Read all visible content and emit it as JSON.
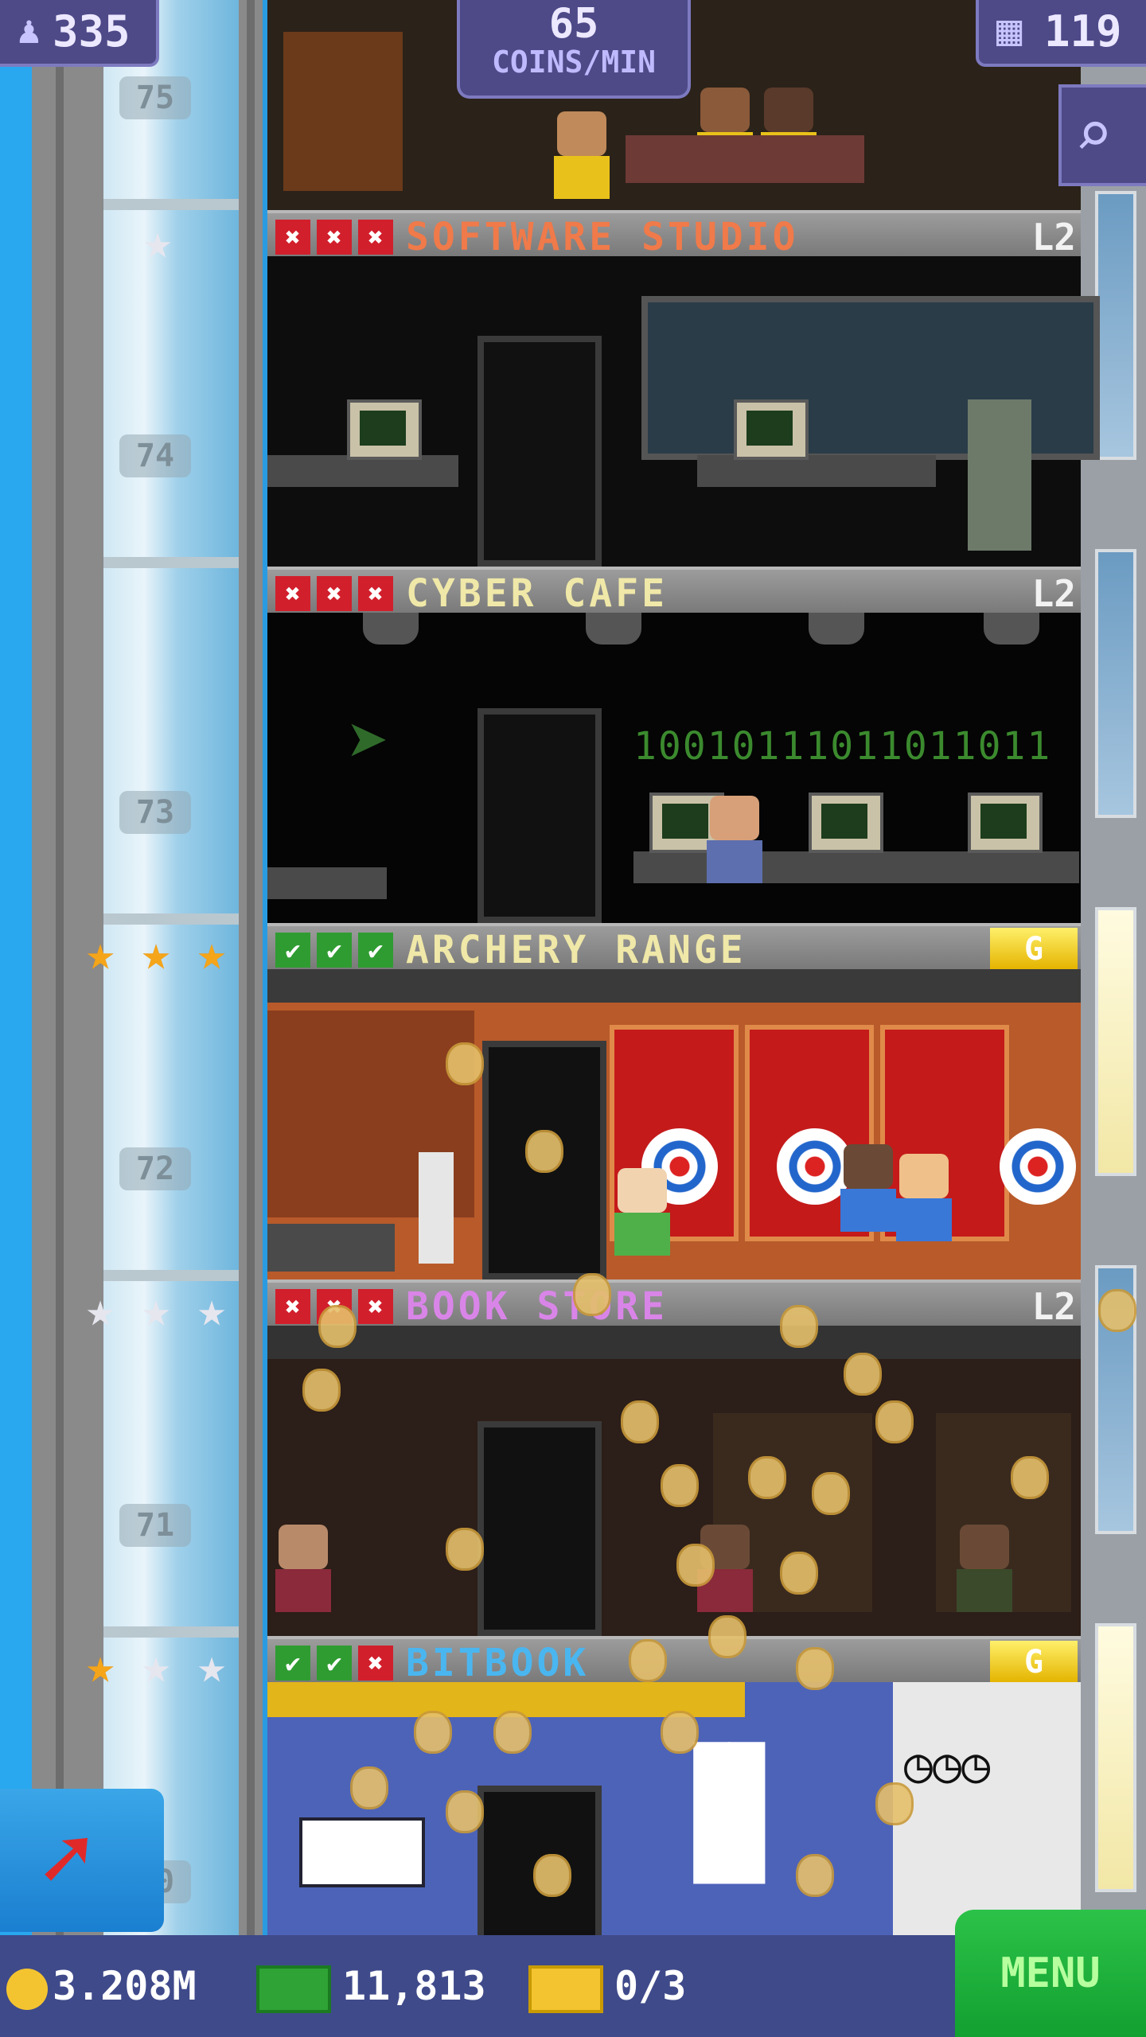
{
  "hud": {
    "population": "335",
    "coins_rate_value": "65",
    "coins_rate_unit": "COINS/MIN",
    "floors": "119"
  },
  "shaft": {
    "floor_numbers": [
      "75",
      "74",
      "73",
      "72",
      "71",
      "70"
    ]
  },
  "floors": [
    {
      "name": "SOFTWARE STUDIO",
      "level": "L2",
      "marks": [
        "x",
        "x",
        "x"
      ],
      "title_color": "#f07a4a",
      "stars": [
        "silver"
      ]
    },
    {
      "name": "CYBER CAFE",
      "level": "L2",
      "marks": [
        "x",
        "x",
        "x"
      ],
      "title_color": "#f0e8a8",
      "stars": []
    },
    {
      "name": "ARCHERY RANGE",
      "level": "G",
      "marks": [
        "ok",
        "ok",
        "ok"
      ],
      "title_color": "#f0e8a8",
      "stars": [
        "gold",
        "gold",
        "gold"
      ]
    },
    {
      "name": "BOOK STORE",
      "level": "L2",
      "marks": [
        "x",
        "x",
        "x"
      ],
      "title_color": "#d985e8",
      "stars": [
        "silver",
        "silver",
        "silver"
      ]
    },
    {
      "name": "BITBOOK",
      "level": "G",
      "marks": [
        "ok",
        "ok",
        "x"
      ],
      "title_color": "#4ab6f0",
      "stars": [
        "gold",
        "silver",
        "silver"
      ]
    }
  ],
  "scenery": {
    "binary_text": "10010111011011011"
  },
  "bottom": {
    "coins": "3.208M",
    "bux": "11,813",
    "tickets": "0/3",
    "menu_label": "MENU"
  },
  "colors": {
    "sky": "#29a8ef",
    "hud_bg": "#4e4a88",
    "menu_bg": "#12a030",
    "check": "#2f9c32",
    "cross": "#d21f2c"
  },
  "icons": [
    "person-icon",
    "building-icon",
    "search-icon",
    "coin-icon",
    "bux-icon",
    "ticket-icon",
    "arrow-icon",
    "star-icon",
    "check-icon",
    "cross-icon"
  ]
}
